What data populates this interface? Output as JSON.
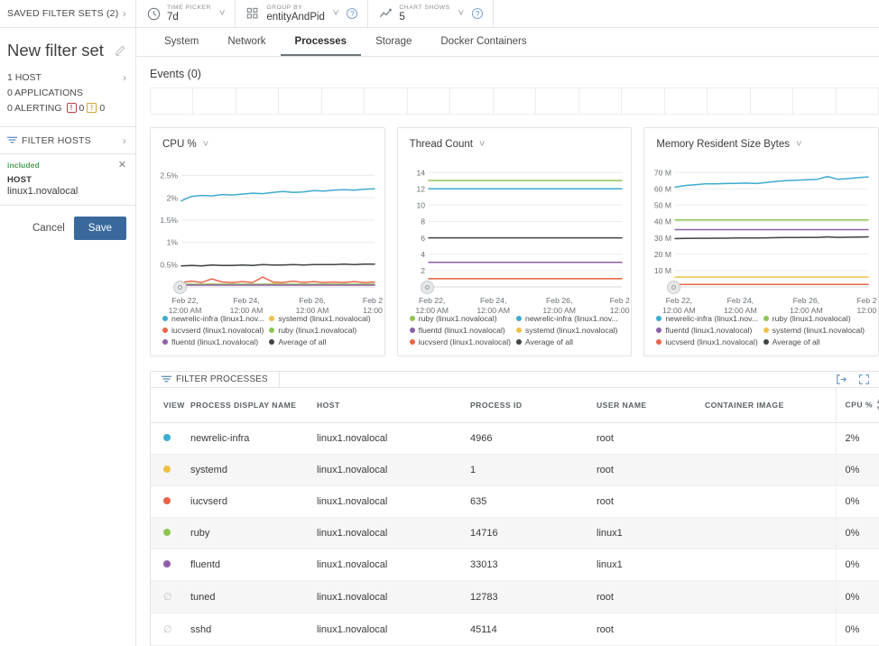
{
  "sidebar": {
    "saved_filter_sets": "SAVED FILTER SETS (2)",
    "filter_set_title": "New filter set",
    "edit_icon": "pencil-icon",
    "stats": [
      {
        "label": "1 HOST",
        "chevron": true
      },
      {
        "label": "0 APPLICATIONS",
        "chevron": false
      }
    ],
    "alerting": {
      "label": "0 ALERTING",
      "critical_count": "0",
      "warning_count": "0"
    },
    "filter_hosts": "FILTER HOSTS",
    "chip": {
      "included_label": "included",
      "key": "HOST",
      "value": "linux1.novalocal",
      "close_icon": "close-icon"
    },
    "cancel_label": "Cancel",
    "save_label": "Save"
  },
  "toolbar": {
    "items": [
      {
        "icon": "clock-icon",
        "caption": "TIME PICKER",
        "value": "7d",
        "help": false
      },
      {
        "icon": "grid-icon",
        "caption": "GROUP BY",
        "value": "entityAndPid",
        "help": true
      },
      {
        "icon": "chart-line-icon",
        "caption": "CHART SHOWS",
        "value": "5",
        "help": true
      }
    ]
  },
  "tabs": [
    {
      "label": "System",
      "active": false
    },
    {
      "label": "Network",
      "active": false
    },
    {
      "label": "Processes",
      "active": true
    },
    {
      "label": "Storage",
      "active": false
    },
    {
      "label": "Docker Containers",
      "active": false
    }
  ],
  "events": {
    "title": "Events (0)",
    "cell_count": 17
  },
  "colors": {
    "newrelic_infra": "#3eabd1",
    "systemd": "#efc14a",
    "iucvserd": "#e8654a",
    "ruby": "#8ec553",
    "fluentd": "#8e5fa8",
    "average": "#3f4448",
    "accent": "#39699c",
    "included_green": "#4c9e55",
    "critical_red": "#bf3f45",
    "warning_yellow": "#d0a83c"
  },
  "chart_data": [
    {
      "type": "line",
      "title": "CPU %",
      "xlabel": "",
      "ylabel": "CPU %",
      "yticks": [
        "2.5%",
        "2%",
        "1.5%",
        "1%",
        "0.5%"
      ],
      "ylim": [
        0,
        2.75
      ],
      "xticks": [
        "Feb 22,\n12:00 AM",
        "Feb 24,\n12:00 AM",
        "Feb 26,\n12:00 AM",
        "Feb 2\n12:00"
      ],
      "grid": true,
      "legend_position": "bottom",
      "series": [
        {
          "name": "newrelic-infra (linux1.nov...",
          "color": "#3eabd1",
          "values": [
            1.93,
            2.03,
            2.05,
            2.04,
            2.07,
            2.06,
            2.08,
            2.1,
            2.09,
            2.12,
            2.14,
            2.12,
            2.13,
            2.16,
            2.15,
            2.17,
            2.18,
            2.17,
            2.19,
            2.2
          ]
        },
        {
          "name": "systemd (linux1.novalocal)",
          "color": "#efc14a",
          "values": [
            0.05,
            0.06,
            0.05,
            0.07,
            0.05,
            0.06,
            0.05,
            0.06,
            0.05,
            0.07,
            0.06,
            0.05,
            0.06,
            0.05,
            0.06,
            0.05,
            0.06,
            0.05,
            0.06,
            0.05
          ]
        },
        {
          "name": "iucvserd (linux1.novalocal)",
          "color": "#e8654a",
          "values": [
            0.1,
            0.13,
            0.1,
            0.18,
            0.11,
            0.1,
            0.12,
            0.1,
            0.22,
            0.11,
            0.1,
            0.13,
            0.1,
            0.12,
            0.1,
            0.11,
            0.1,
            0.12,
            0.1,
            0.11
          ]
        },
        {
          "name": "ruby (linux1.novalocal)",
          "color": "#8ec553",
          "values": [
            0.06,
            0.06,
            0.06,
            0.06,
            0.06,
            0.06,
            0.06,
            0.06,
            0.06,
            0.06,
            0.06,
            0.06,
            0.06,
            0.06,
            0.06,
            0.06,
            0.06,
            0.06,
            0.06,
            0.06
          ]
        },
        {
          "name": "fluentd (linux1.novalocal)",
          "color": "#8e5fa8",
          "values": [
            0.04,
            0.04,
            0.04,
            0.04,
            0.04,
            0.04,
            0.04,
            0.04,
            0.04,
            0.04,
            0.04,
            0.04,
            0.04,
            0.04,
            0.04,
            0.04,
            0.04,
            0.04,
            0.04,
            0.04
          ]
        },
        {
          "name": "Average of all",
          "color": "#3f4448",
          "values": [
            0.47,
            0.48,
            0.47,
            0.49,
            0.48,
            0.48,
            0.49,
            0.48,
            0.5,
            0.49,
            0.49,
            0.5,
            0.49,
            0.5,
            0.5,
            0.5,
            0.51,
            0.5,
            0.51,
            0.51
          ]
        }
      ]
    },
    {
      "type": "line",
      "title": "Thread Count",
      "xlabel": "",
      "ylabel": "Thread Count",
      "yticks": [
        "14",
        "12",
        "10",
        "8",
        "6",
        "4",
        "2"
      ],
      "ylim": [
        0,
        15
      ],
      "xticks": [
        "Feb 22,\n12:00 AM",
        "Feb 24,\n12:00 AM",
        "Feb 26,\n12:00 AM",
        "Feb 2\n12:00"
      ],
      "grid": true,
      "legend_position": "bottom",
      "series": [
        {
          "name": "ruby (linux1.novalocal)",
          "color": "#8ec553",
          "values": [
            13,
            13,
            13,
            13,
            13,
            13,
            13,
            13,
            13,
            13,
            13,
            13,
            13,
            13,
            13,
            13,
            13,
            13,
            13,
            13
          ]
        },
        {
          "name": "newrelic-infra (linux1.nov...",
          "color": "#3eabd1",
          "values": [
            12,
            12,
            12,
            12,
            12,
            12,
            12,
            12,
            12,
            12,
            12,
            12,
            12,
            12,
            12,
            12,
            12,
            12,
            12,
            12
          ]
        },
        {
          "name": "fluentd (linux1.novalocal)",
          "color": "#8e5fa8",
          "values": [
            3,
            3,
            3,
            3,
            3,
            3,
            3,
            3,
            3,
            3,
            3,
            3,
            3,
            3,
            3,
            3,
            3,
            3,
            3,
            3
          ]
        },
        {
          "name": "systemd (linux1.novalocal)",
          "color": "#efc14a",
          "values": [
            1,
            1,
            1,
            1,
            1,
            1,
            1,
            1,
            1,
            1,
            1,
            1,
            1,
            1,
            1,
            1,
            1,
            1,
            1,
            1
          ]
        },
        {
          "name": "iucvserd (linux1.novalocal)",
          "color": "#e8654a",
          "values": [
            1,
            1,
            1,
            1,
            1,
            1,
            1,
            1,
            1,
            1,
            1,
            1,
            1,
            1,
            1,
            1,
            1,
            1,
            1,
            1
          ]
        },
        {
          "name": "Average of all",
          "color": "#3f4448",
          "values": [
            6,
            6,
            6,
            6,
            6,
            6,
            6,
            6,
            6,
            6,
            6,
            6,
            6,
            6,
            6,
            6,
            6,
            6,
            6,
            6
          ]
        }
      ]
    },
    {
      "type": "line",
      "title": "Memory Resident Size Bytes",
      "xlabel": "",
      "ylabel": "Memory Resident Size Bytes",
      "yticks": [
        "70 M",
        "60 M",
        "50 M",
        "40 M",
        "30 M",
        "20 M",
        "10 M"
      ],
      "ylim": [
        0,
        75
      ],
      "xticks": [
        "Feb 22,\n12:00 AM",
        "Feb 24,\n12:00 AM",
        "Feb 26,\n12:00 AM",
        "Feb 2\n12:00"
      ],
      "grid": true,
      "legend_position": "bottom",
      "series": [
        {
          "name": "newrelic-infra (linux1.nov...",
          "color": "#3eabd1",
          "values": [
            61,
            62,
            62.5,
            63,
            63,
            63.2,
            63.3,
            63.5,
            63.2,
            63.8,
            64.5,
            65,
            65.2,
            65.5,
            65.8,
            67.5,
            65.8,
            66.2,
            66.8,
            67.2
          ]
        },
        {
          "name": "ruby (linux1.novalocal)",
          "color": "#8ec553",
          "values": [
            41,
            41,
            41,
            41,
            41,
            41,
            41,
            41,
            41,
            41,
            41,
            41,
            41,
            41,
            41,
            41,
            41,
            41,
            41,
            41
          ]
        },
        {
          "name": "fluentd (linux1.novalocal)",
          "color": "#8e5fa8",
          "values": [
            35,
            35,
            35,
            35,
            35,
            35,
            35,
            35,
            35,
            35,
            35,
            35,
            35,
            35,
            35,
            35,
            35,
            35,
            35,
            35
          ]
        },
        {
          "name": "systemd (linux1.novalocal)",
          "color": "#efc14a",
          "values": [
            6,
            6,
            6,
            6,
            6,
            6,
            6,
            6,
            6,
            6,
            6,
            6,
            6,
            6,
            6,
            6,
            6,
            6,
            6,
            6
          ]
        },
        {
          "name": "iucvserd (linux1.novalocal)",
          "color": "#e8654a",
          "values": [
            1.5,
            1.5,
            1.5,
            1.5,
            1.5,
            1.5,
            1.5,
            1.5,
            1.5,
            1.5,
            1.5,
            1.5,
            1.5,
            1.5,
            1.5,
            1.5,
            1.5,
            1.5,
            1.5,
            1.5
          ]
        },
        {
          "name": "Average of all",
          "color": "#3f4448",
          "values": [
            29.5,
            29.6,
            29.7,
            29.7,
            29.8,
            29.8,
            29.9,
            29.9,
            29.9,
            30,
            30.1,
            30.2,
            30.2,
            30.3,
            30.3,
            30.6,
            30.3,
            30.4,
            30.5,
            30.6
          ]
        }
      ]
    }
  ],
  "table": {
    "filter_label": "FILTER PROCESSES",
    "export_icon": "export-icon",
    "expand_icon": "expand-icon",
    "columns": [
      "VIEW",
      "PROCESS DISPLAY NAME",
      "HOST",
      "PROCESS ID",
      "USER NAME",
      "CONTAINER IMAGE",
      "CPU %"
    ],
    "sort_column": "CPU %",
    "rows": [
      {
        "dot": "#3eabd1",
        "name": "newrelic-infra",
        "host": "linux1.novalocal",
        "pid": "4966",
        "user": "root",
        "image": "",
        "cpu": "2%"
      },
      {
        "dot": "#efc14a",
        "name": "systemd",
        "host": "linux1.novalocal",
        "pid": "1",
        "user": "root",
        "image": "",
        "cpu": "0%"
      },
      {
        "dot": "#e8654a",
        "name": "iucvserd",
        "host": "linux1.novalocal",
        "pid": "635",
        "user": "root",
        "image": "",
        "cpu": "0%"
      },
      {
        "dot": "#8ec553",
        "name": "ruby",
        "host": "linux1.novalocal",
        "pid": "14716",
        "user": "linux1",
        "image": "",
        "cpu": "0%"
      },
      {
        "dot": "#8e5fa8",
        "name": "fluentd",
        "host": "linux1.novalocal",
        "pid": "33013",
        "user": "linux1",
        "image": "",
        "cpu": "0%"
      },
      {
        "dot": null,
        "name": "tuned",
        "host": "linux1.novalocal",
        "pid": "12783",
        "user": "root",
        "image": "",
        "cpu": "0%"
      },
      {
        "dot": null,
        "name": "sshd",
        "host": "linux1.novalocal",
        "pid": "45114",
        "user": "root",
        "image": "",
        "cpu": "0%"
      }
    ]
  }
}
